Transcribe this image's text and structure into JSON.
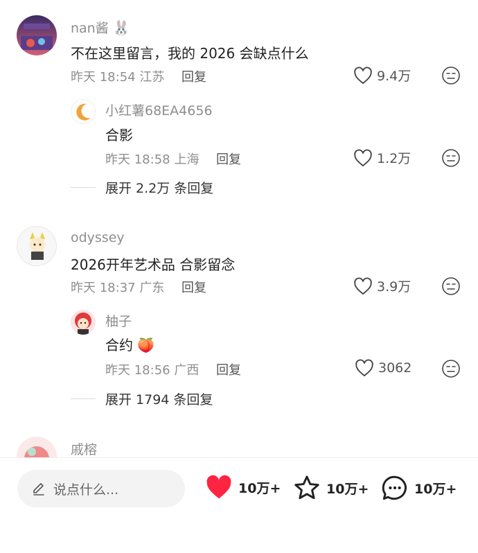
{
  "comments": [
    {
      "name": "nan酱",
      "emoji": "🐰",
      "text": "不在这里留言，我的 2026 会缺点什么",
      "time": "昨天 18:54",
      "location": "江苏",
      "reply_label": "回复",
      "likes": "9.4万",
      "reply": {
        "name": "小红薯68EA4656",
        "text": "合影",
        "time": "昨天 18:58",
        "location": "上海",
        "reply_label": "回复",
        "likes": "1.2万"
      },
      "expand": "展开 2.2万 条回复"
    },
    {
      "name": "odyssey",
      "text": "2026开年艺术品 合影留念",
      "time": "昨天 18:37",
      "location": "广东",
      "reply_label": "回复",
      "likes": "3.9万",
      "reply": {
        "name": "柚子",
        "text": "合约",
        "emoji": "🍑",
        "time": "昨天 18:56",
        "location": "广西",
        "reply_label": "回复",
        "likes": "3062"
      },
      "expand": "展开 1794 条回复"
    },
    {
      "name": "戚榕"
    }
  ],
  "bottom_bar": {
    "input_placeholder": "说点什么...",
    "like_count": "10万+",
    "collect_count": "10万+",
    "comment_count": "10万+"
  },
  "colors": {
    "like_red": "#ff2442",
    "meta_gray": "#8e8e8e"
  },
  "icons": [
    "heart-outline-icon",
    "dislike-face-icon",
    "pencil-icon",
    "heart-filled-icon",
    "star-icon",
    "comment-bubble-icon"
  ]
}
